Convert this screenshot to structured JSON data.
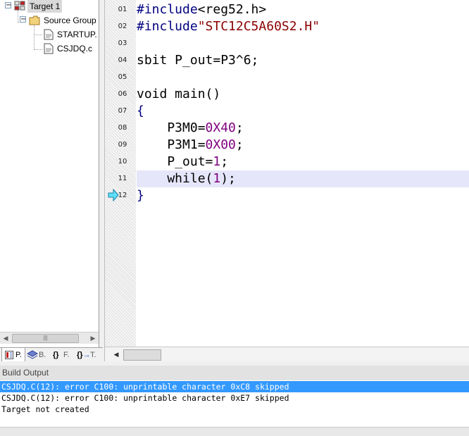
{
  "project": {
    "target": "Target 1",
    "source_group": "Source Group",
    "files": [
      "STARTUP.",
      "CSJDQ.c"
    ]
  },
  "left_tabs": [
    "P.",
    "B.",
    "F.",
    "T."
  ],
  "editor": {
    "current_line": "11",
    "lines": [
      {
        "no": "01",
        "parts": [
          {
            "t": "#include",
            "c": "kw"
          },
          {
            "t": "<reg52.h>",
            "c": ""
          }
        ]
      },
      {
        "no": "02",
        "parts": [
          {
            "t": "#include",
            "c": "kw"
          },
          {
            "t": "\"STC12C5A60S2.H\"",
            "c": "str"
          }
        ]
      },
      {
        "no": "03",
        "parts": []
      },
      {
        "no": "04",
        "parts": [
          {
            "t": "sbit P_out=P3^6;",
            "c": ""
          }
        ]
      },
      {
        "no": "05",
        "parts": []
      },
      {
        "no": "06",
        "parts": [
          {
            "t": "void main()",
            "c": ""
          }
        ]
      },
      {
        "no": "07",
        "parts": [
          {
            "t": "{",
            "c": "kw"
          }
        ]
      },
      {
        "no": "08",
        "parts": [
          {
            "t": "    P3M0=",
            "c": ""
          },
          {
            "t": "0X40",
            "c": "num"
          },
          {
            "t": ";",
            "c": ""
          }
        ]
      },
      {
        "no": "09",
        "parts": [
          {
            "t": "    P3M1=",
            "c": ""
          },
          {
            "t": "0X00",
            "c": "num"
          },
          {
            "t": ";",
            "c": ""
          }
        ]
      },
      {
        "no": "10",
        "parts": [
          {
            "t": "    P_out=",
            "c": ""
          },
          {
            "t": "1",
            "c": "num"
          },
          {
            "t": ";",
            "c": ""
          }
        ]
      },
      {
        "no": "11",
        "parts": [
          {
            "t": "    while(",
            "c": ""
          },
          {
            "t": "1",
            "c": "num"
          },
          {
            "t": ");",
            "c": ""
          }
        ]
      },
      {
        "no": "12",
        "parts": [
          {
            "t": "}",
            "c": "kw"
          }
        ]
      }
    ]
  },
  "build_output": {
    "title": "Build Output",
    "lines": [
      "CSJDQ.C(12): error C100: unprintable character 0xC8 skipped",
      "CSJDQ.C(12): error C100: unprintable character 0xE7 skipped",
      "Target not created"
    ],
    "selected_index": 0
  },
  "colors": {
    "keyword": "#000080",
    "string": "#8b0000",
    "number": "#800080",
    "current_line_bg": "#e6e6fa",
    "selection_bg": "#3399ff"
  }
}
